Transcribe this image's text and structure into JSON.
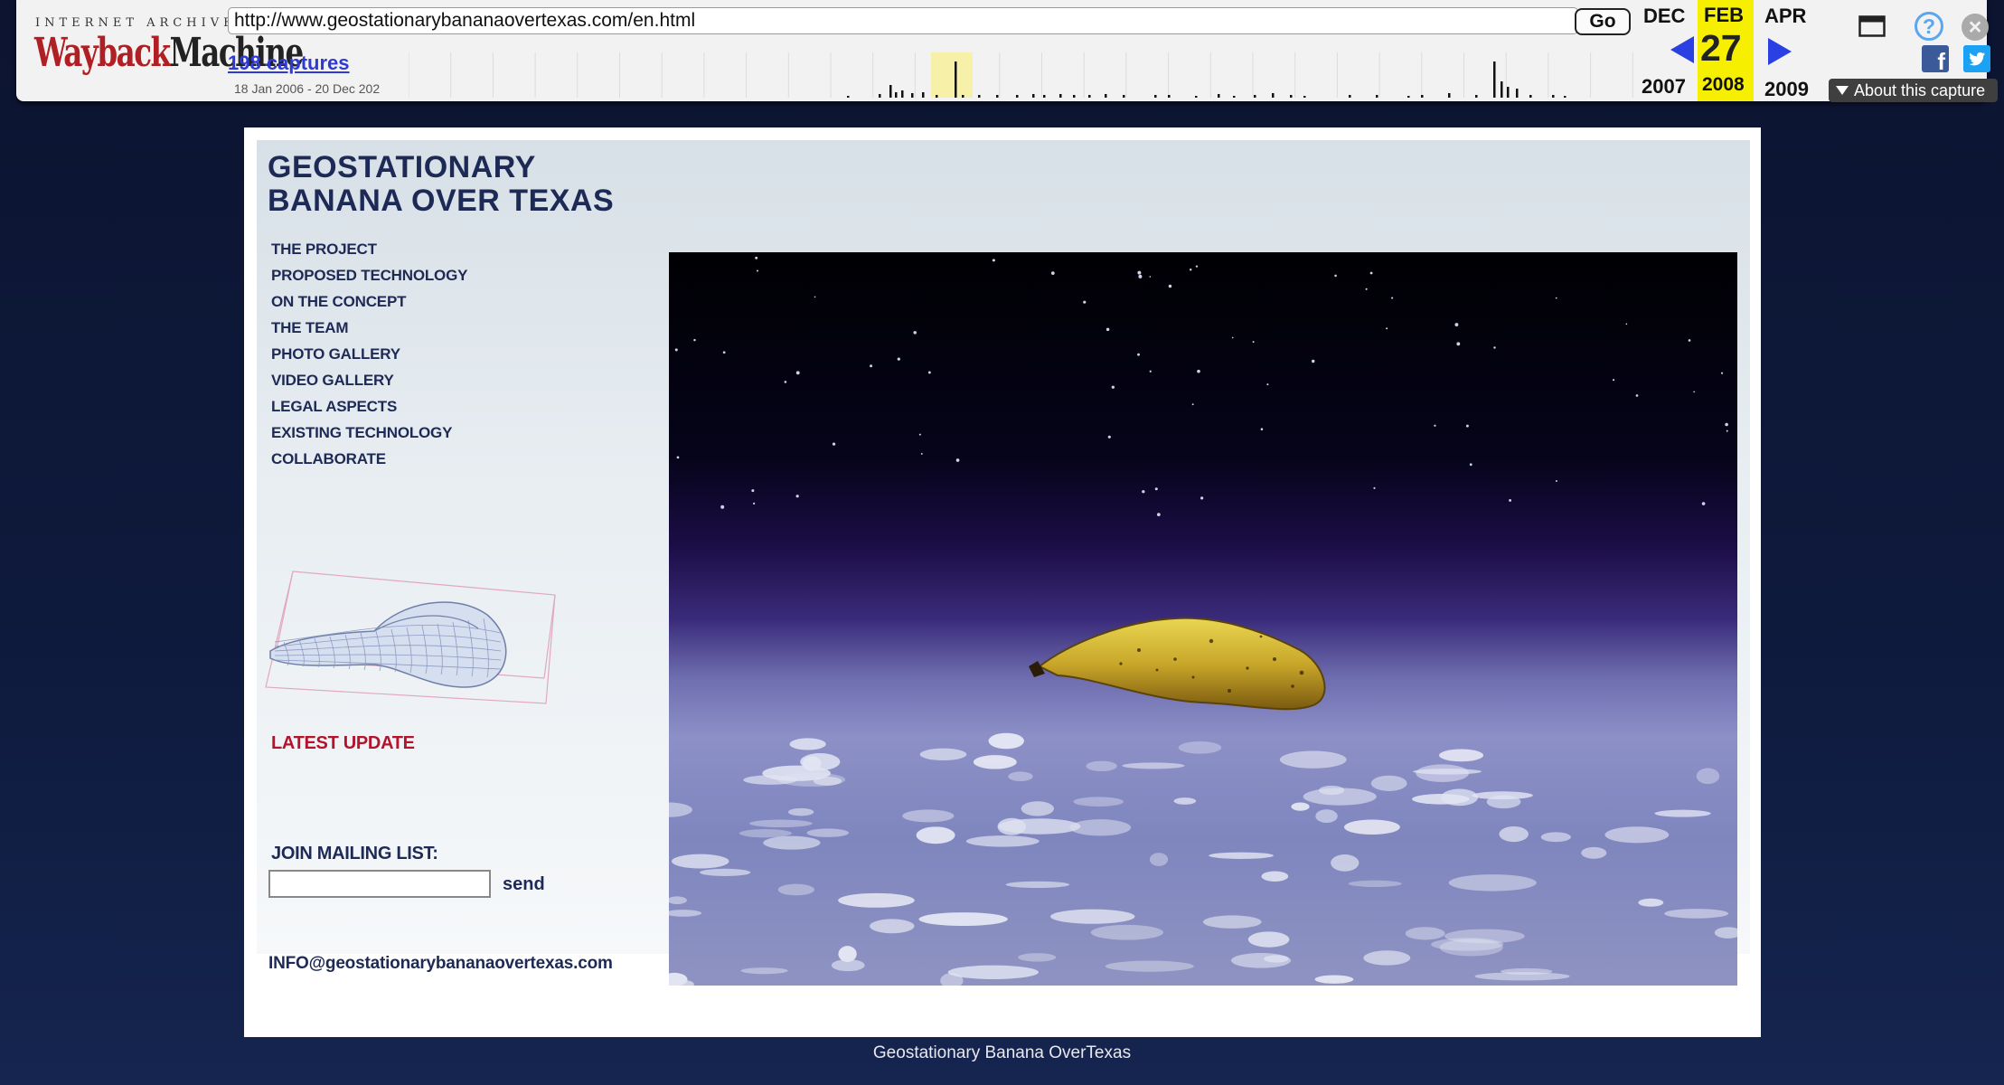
{
  "wayback": {
    "logo_top": "INTERNET ARCHIVE",
    "logo_way": "Wayback",
    "logo_machine": "Machine",
    "url": "http://www.geostationarybananaovertexas.com/en.html",
    "go_label": "Go",
    "captures_label": "198 captures",
    "captures_range": "18 Jan 2006 - 20 Dec 202",
    "calendar": {
      "prev_month": "DEC",
      "current_month": "FEB",
      "next_month": "APR",
      "current_day": "27",
      "prev_year": "2007",
      "current_year": "2008",
      "next_year": "2009"
    },
    "about_label": "About this capture",
    "icons": {
      "prev": "prev-capture-arrow-icon",
      "next": "next-capture-arrow-icon",
      "window": "window-icon",
      "help": "help-icon",
      "close": "close-icon",
      "facebook": "facebook-icon",
      "twitter": "twitter-icon"
    },
    "accent_color": "#2a40e3",
    "highlight_color": "#f7ef00"
  },
  "site": {
    "title_line1": "GEOSTATIONARY",
    "title_line2": "BANANA OVER TEXAS",
    "nav": [
      "THE PROJECT",
      "PROPOSED TECHNOLOGY",
      "ON THE CONCEPT",
      "THE TEAM",
      "PHOTO GALLERY",
      "VIDEO GALLERY",
      "LEGAL ASPECTS",
      "EXISTING TECHNOLOGY",
      "COLLABORATE"
    ],
    "latest_update": "LATEST UPDATE",
    "mailing_label": "JOIN MAILING LIST:",
    "email_value": "",
    "send_label": "send",
    "info_email": "INFO@geostationarybananaovertexas.com",
    "title_color": "#1e2a56",
    "update_color": "#b4132c"
  },
  "footer": {
    "caption": "Geostationary Banana OverTexas"
  }
}
